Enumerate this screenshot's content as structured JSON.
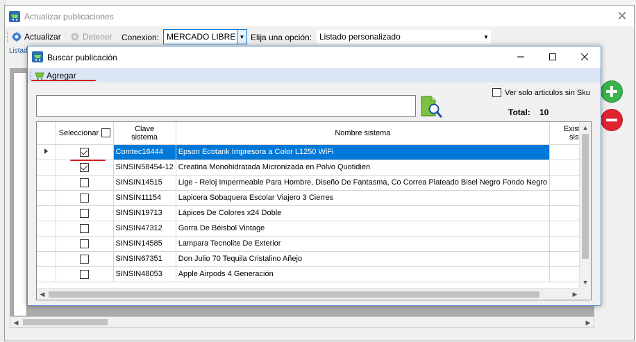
{
  "outer_window": {
    "title": "Actualizar publicaciones",
    "close_glyph": "✕",
    "tab_label": "Listad"
  },
  "toolbar": {
    "actualizar_label": "Actualizar",
    "detener_label": "Detener",
    "conexion_label": "Conexion:",
    "conexion_value": "MERCADO LIBRE",
    "opcion_label": "Elija una opción:",
    "opcion_value": "Listado personalizado"
  },
  "dialog": {
    "title": "Buscar publicación",
    "agregar_label": "Agregar",
    "ver_solo_label": "Ver solo articulos sin Sku",
    "ver_solo_checked": false,
    "search_value": "",
    "total_label": "Total:",
    "total_value": "10"
  },
  "grid": {
    "columns": {
      "select": "Seleccionar",
      "clave_line1": "Clave",
      "clave_line2": "sistema",
      "nombre": "Nombre sistema",
      "exist_line1": "Existen",
      "exist_line2": "siste"
    },
    "rows": [
      {
        "selected": true,
        "checked": true,
        "clave": "Comtec16444",
        "nombre": "Epson Ecotank Impresora a Color L1250 WiFi"
      },
      {
        "selected": false,
        "checked": true,
        "clave": "SINSIN58454-12",
        "nombre": "Creatina Monohidratada Micronizada en Polvo Quotidien"
      },
      {
        "selected": false,
        "checked": false,
        "clave": "SINSIN14515",
        "nombre": "Lige - Reloj Impermeable Para Hombre, Diseño De Fantasma, Co Correa Plateado Bisel Negro Fondo Negro"
      },
      {
        "selected": false,
        "checked": false,
        "clave": "SINSIN11154",
        "nombre": "Lapicera Sobaquera Escolar Viajero 3 Cierres"
      },
      {
        "selected": false,
        "checked": false,
        "clave": "SINSIN19713",
        "nombre": "Lápices De Colores x24 Doble"
      },
      {
        "selected": false,
        "checked": false,
        "clave": "SINSIN47312",
        "nombre": "Gorra De Béisbol Vintage"
      },
      {
        "selected": false,
        "checked": false,
        "clave": "SINSIN14585",
        "nombre": "Lampara Tecnolite De Exterior"
      },
      {
        "selected": false,
        "checked": false,
        "clave": "SINSIN67351",
        "nombre": "Don Julio 70 Tequila Cristalino Añejo"
      },
      {
        "selected": false,
        "checked": false,
        "clave": "SINSIN48053",
        "nombre": "Apple Airpods 4 Generación"
      }
    ]
  },
  "colors": {
    "selection_blue": "#0078d7",
    "menubar_blue": "#dbe6f4",
    "add_green": "#39b54a",
    "remove_red": "#e0242e",
    "annotation_red": "#d01d1d"
  },
  "icons": [
    "app-cart-icon",
    "actualizar-gear-icon",
    "detener-gear-icon",
    "dropdown-arrow-icon",
    "minimize-icon",
    "maximize-icon",
    "close-icon",
    "agregar-cart-icon",
    "search-document-icon",
    "add-circle-icon",
    "remove-circle-icon",
    "row-pointer-icon"
  ]
}
